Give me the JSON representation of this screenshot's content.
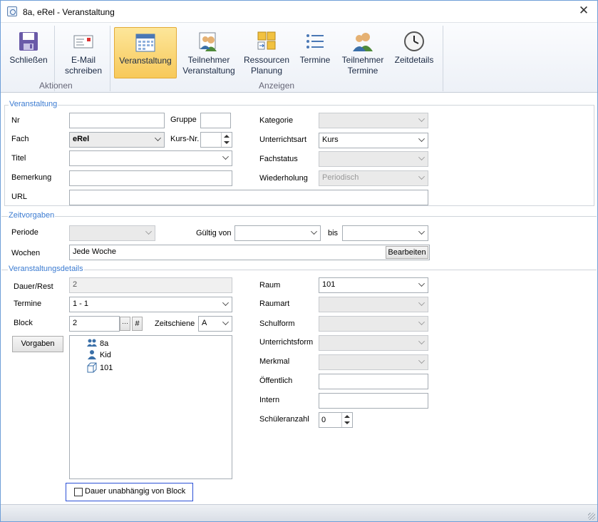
{
  "window": {
    "title": "8a, eRel - Veranstaltung",
    "close": "✕"
  },
  "ribbon": {
    "buttons": [
      {
        "label1": "Schließen",
        "label2": "",
        "icon": "save-icon"
      },
      {
        "label1": "E-Mail",
        "label2": "schreiben",
        "icon": "email-icon"
      },
      {
        "label1": "Veranstaltung",
        "label2": "",
        "icon": "calendar-icon"
      },
      {
        "label1": "Teilnehmer",
        "label2": "Veranstaltung",
        "icon": "participants-icon"
      },
      {
        "label1": "Ressourcen",
        "label2": "Planung",
        "icon": "resources-icon"
      },
      {
        "label1": "Termine",
        "label2": "",
        "icon": "list-icon"
      },
      {
        "label1": "Teilnehmer",
        "label2": "Termine",
        "icon": "participants-dates-icon"
      },
      {
        "label1": "Zeitdetails",
        "label2": "",
        "icon": "clock-icon"
      }
    ],
    "groups": {
      "aktionen": "Aktionen",
      "anzeigen": "Anzeigen"
    }
  },
  "veranstaltung": {
    "legend": "Veranstaltung",
    "nr_label": "Nr",
    "nr_value": "",
    "gruppe_label": "Gruppe",
    "gruppe_value": "",
    "kategorie_label": "Kategorie",
    "kategorie_value": "",
    "fach_label": "Fach",
    "fach_value": "eRel",
    "kursnr_label": "Kurs-Nr.",
    "kursnr_value": "",
    "unterrichtsart_label": "Unterrichtsart",
    "unterrichtsart_value": "Kurs",
    "titel_label": "Titel",
    "titel_value": "",
    "fachstatus_label": "Fachstatus",
    "fachstatus_value": "",
    "bemerkung_label": "Bemerkung",
    "bemerkung_value": "",
    "wiederholung_label": "Wiederholung",
    "wiederholung_value": "Periodisch",
    "url_label": "URL",
    "url_value": ""
  },
  "zeitvorgaben": {
    "legend": "Zeitvorgaben",
    "periode_label": "Periode",
    "periode_value": "",
    "gueltig_label": "Gültig von",
    "gueltig_value": "",
    "bis_label": "bis",
    "bis_value": "",
    "wochen_label": "Wochen",
    "wochen_value": "Jede Woche",
    "bearbeiten": "Bearbeiten"
  },
  "details": {
    "legend": "Veranstaltungsdetails",
    "dauer_label": "Dauer/Rest",
    "dauer_value": "2",
    "termine_label": "Termine",
    "termine_value": "1 - 1",
    "block_label": "Block",
    "block_value": "2",
    "block_more": "···",
    "block_hash": "#",
    "zeitschiene_label": "Zeitschiene",
    "zeitschiene_value": "A",
    "vorgaben": "Vorgaben",
    "tree": [
      {
        "label": "8a",
        "icon": "class-group-icon"
      },
      {
        "label": "Kid",
        "icon": "teacher-icon"
      },
      {
        "label": "101",
        "icon": "room-cube-icon"
      }
    ],
    "raum_label": "Raum",
    "raum_value": "101",
    "raumart_label": "Raumart",
    "raumart_value": "",
    "schulform_label": "Schulform",
    "schulform_value": "",
    "unterrichtsform_label": "Unterrichtsform",
    "unterrichtsform_value": "",
    "merkmal_label": "Merkmal",
    "merkmal_value": "",
    "oeffentlich_label": "Öffentlich",
    "oeffentlich_value": "",
    "intern_label": "Intern",
    "intern_value": "",
    "schueleranzahl_label": "Schüleranzahl",
    "schueleranzahl_value": "0",
    "dauer_unabhaengig_label": "Dauer unabhängig von Block",
    "dauer_unabhaengig_checked": false
  }
}
